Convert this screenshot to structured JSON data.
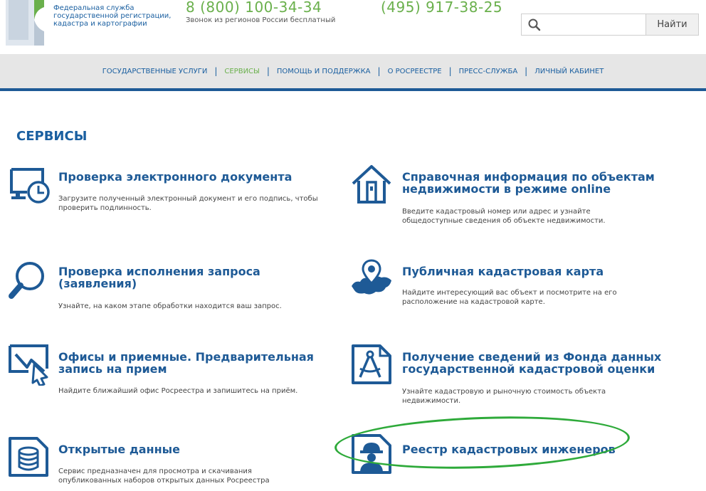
{
  "header": {
    "org_name_lines": [
      "Федеральная служба",
      "государственной регистрации,",
      "кадастра и картографии"
    ],
    "phone_primary": "8 (800) 100-34-34",
    "phone_primary_note": "Звонок из регионов России бесплатный",
    "phone_secondary": "(495) 917-38-25",
    "search": {
      "value": "",
      "placeholder": "",
      "button_label": "Найти"
    }
  },
  "nav": {
    "items": [
      {
        "label": "ГОСУДАРСТВЕННЫЕ УСЛУГИ",
        "active": false
      },
      {
        "label": "СЕРВИСЫ",
        "active": true
      },
      {
        "label": "ПОМОЩЬ И ПОДДЕРЖКА",
        "active": false
      },
      {
        "label": "О РОСРЕЕСТРЕ",
        "active": false
      },
      {
        "label": "ПРЕСС-СЛУЖБА",
        "active": false
      },
      {
        "label": "ЛИЧНЫЙ КАБИНЕТ",
        "active": false
      }
    ],
    "separator": "|"
  },
  "page_title": "СЕРВИСЫ",
  "services": [
    {
      "icon": "monitor-clock-icon",
      "title": "Проверка электронного документа",
      "desc": "Загрузите полученный электронный документ и его подпись, чтобы проверить подлинность."
    },
    {
      "icon": "house-icon",
      "title": "Справочная информация по объектам недвижимости в режиме online",
      "desc": "Введите кадастровый номер или адрес и узнайте общедоступные сведения об объекте недвижимости."
    },
    {
      "icon": "magnifier-icon",
      "title": "Проверка исполнения запроса (заявления)",
      "desc": "Узнайте, на каком этапе обработки находится ваш запрос."
    },
    {
      "icon": "map-pin-icon",
      "title": "Публичная кадастровая карта",
      "desc": "Найдите интересующий вас объект и посмотрите на его расположение на кадастровой карте."
    },
    {
      "icon": "screen-cursor-icon",
      "title": "Офисы и приемные. Предварительная запись на прием",
      "desc": "Найдите ближайший офис Росреестра и запишитесь на приём."
    },
    {
      "icon": "compass-document-icon",
      "title": "Получение сведений из Фонда данных государственной кадастровой оценки",
      "desc": "Узнайте кадастровую и рыночную стоимость объекта недвижимости."
    },
    {
      "icon": "database-document-icon",
      "title": "Открытые данные",
      "desc": "Сервис предназначен для просмотра и скачивания опубликованных наборов открытых данных Росреестра"
    },
    {
      "icon": "engineer-document-icon",
      "title": "Реестр кадастровых инженеров",
      "desc": ""
    }
  ],
  "colors": {
    "brand_blue": "#1e5a96",
    "accent_green": "#6ab04c",
    "highlight_green": "#2eaa3a"
  }
}
